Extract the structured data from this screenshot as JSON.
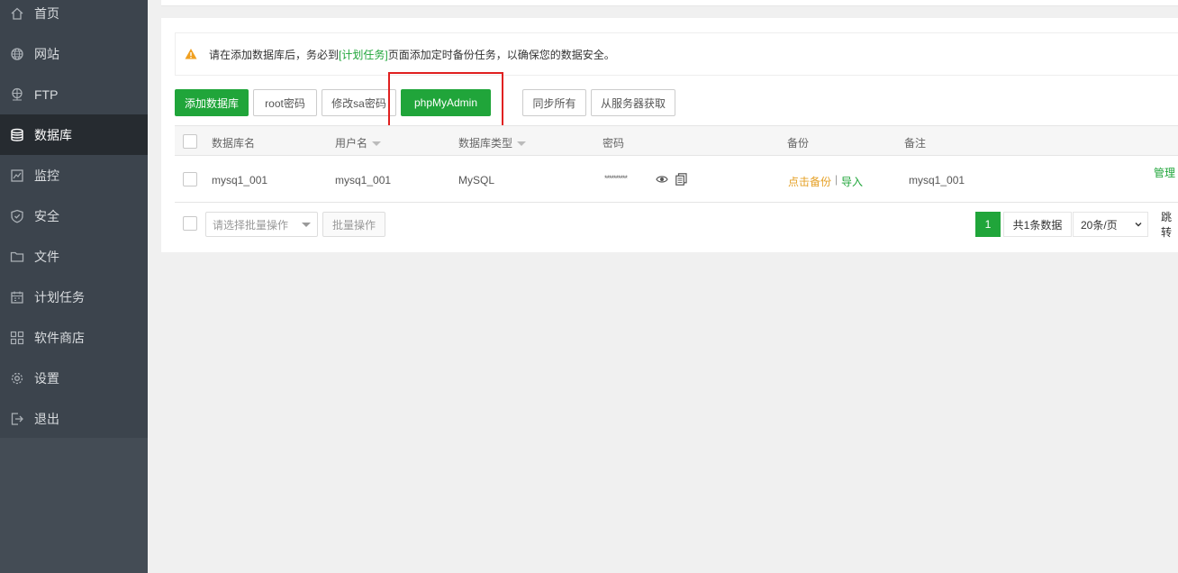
{
  "sidebar": {
    "items": [
      {
        "label": "首页",
        "icon": "home-icon"
      },
      {
        "label": "网站",
        "icon": "globe-icon"
      },
      {
        "label": "FTP",
        "icon": "ftp-icon"
      },
      {
        "label": "数据库",
        "icon": "database-icon",
        "active": true
      },
      {
        "label": "监控",
        "icon": "monitor-icon"
      },
      {
        "label": "安全",
        "icon": "shield-icon"
      },
      {
        "label": "文件",
        "icon": "folder-icon"
      },
      {
        "label": "计划任务",
        "icon": "calendar-icon"
      },
      {
        "label": "软件商店",
        "icon": "grid-icon"
      },
      {
        "label": "设置",
        "icon": "gear-icon"
      },
      {
        "label": "退出",
        "icon": "logout-icon"
      }
    ]
  },
  "notice": {
    "prefix": "请在添加数据库后，务必到",
    "link": "[计划任务]",
    "suffix": "页面添加定时备份任务，以确保您的数据安全。"
  },
  "toolbar": {
    "add_db": "添加数据库",
    "root_pwd": "root密码",
    "sa_pwd": "修改sa密码",
    "phpmyadmin": "phpMyAdmin",
    "sync_all": "同步所有",
    "fetch_server": "从服务器获取"
  },
  "table": {
    "headers": {
      "name": "数据库名",
      "user": "用户名",
      "type": "数据库类型",
      "password": "密码",
      "backup": "备份",
      "note": "备注"
    },
    "rows": [
      {
        "name": "mysq1_001",
        "user": "mysq1_001",
        "type": "MySQL",
        "password": "**********",
        "backup_action": "点击备份",
        "separator": "|",
        "import_action": "导入",
        "note": "mysq1_001",
        "manage": "管理"
      }
    ]
  },
  "footer": {
    "batch_placeholder": "请选择批量操作",
    "batch_button": "批量操作",
    "current_page": "1",
    "total": "共1条数据",
    "page_size": "20条/页",
    "jump": "跳转"
  },
  "colors": {
    "accent": "#20a53a",
    "sidebar_bg": "#3c444d",
    "sidebar_active": "#262b30",
    "warning": "#f0a020",
    "backup_link": "#e5a026",
    "highlight_border": "#e02020"
  }
}
